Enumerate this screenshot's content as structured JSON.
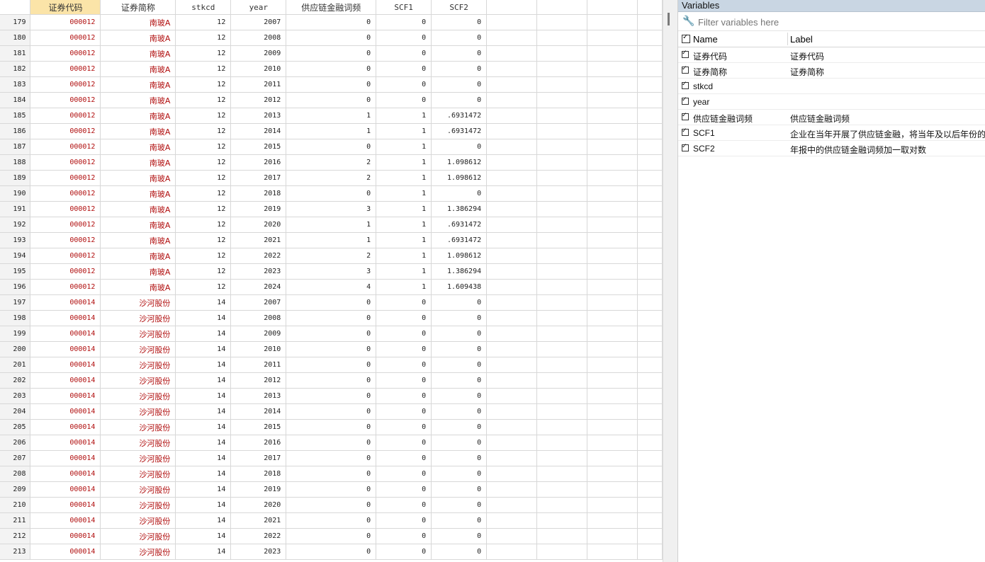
{
  "grid": {
    "columns": [
      "证券代码",
      "证券简称",
      "stkcd",
      "year",
      "供应链金融词频",
      "SCF1",
      "SCF2"
    ],
    "rows": [
      [
        "179",
        "000012",
        "南玻A",
        "12",
        "2007",
        "0",
        "0",
        "0"
      ],
      [
        "180",
        "000012",
        "南玻A",
        "12",
        "2008",
        "0",
        "0",
        "0"
      ],
      [
        "181",
        "000012",
        "南玻A",
        "12",
        "2009",
        "0",
        "0",
        "0"
      ],
      [
        "182",
        "000012",
        "南玻A",
        "12",
        "2010",
        "0",
        "0",
        "0"
      ],
      [
        "183",
        "000012",
        "南玻A",
        "12",
        "2011",
        "0",
        "0",
        "0"
      ],
      [
        "184",
        "000012",
        "南玻A",
        "12",
        "2012",
        "0",
        "0",
        "0"
      ],
      [
        "185",
        "000012",
        "南玻A",
        "12",
        "2013",
        "1",
        "1",
        ".6931472"
      ],
      [
        "186",
        "000012",
        "南玻A",
        "12",
        "2014",
        "1",
        "1",
        ".6931472"
      ],
      [
        "187",
        "000012",
        "南玻A",
        "12",
        "2015",
        "0",
        "1",
        "0"
      ],
      [
        "188",
        "000012",
        "南玻A",
        "12",
        "2016",
        "2",
        "1",
        "1.098612"
      ],
      [
        "189",
        "000012",
        "南玻A",
        "12",
        "2017",
        "2",
        "1",
        "1.098612"
      ],
      [
        "190",
        "000012",
        "南玻A",
        "12",
        "2018",
        "0",
        "1",
        "0"
      ],
      [
        "191",
        "000012",
        "南玻A",
        "12",
        "2019",
        "3",
        "1",
        "1.386294"
      ],
      [
        "192",
        "000012",
        "南玻A",
        "12",
        "2020",
        "1",
        "1",
        ".6931472"
      ],
      [
        "193",
        "000012",
        "南玻A",
        "12",
        "2021",
        "1",
        "1",
        ".6931472"
      ],
      [
        "194",
        "000012",
        "南玻A",
        "12",
        "2022",
        "2",
        "1",
        "1.098612"
      ],
      [
        "195",
        "000012",
        "南玻A",
        "12",
        "2023",
        "3",
        "1",
        "1.386294"
      ],
      [
        "196",
        "000012",
        "南玻A",
        "12",
        "2024",
        "4",
        "1",
        "1.609438"
      ],
      [
        "197",
        "000014",
        "沙河股份",
        "14",
        "2007",
        "0",
        "0",
        "0"
      ],
      [
        "198",
        "000014",
        "沙河股份",
        "14",
        "2008",
        "0",
        "0",
        "0"
      ],
      [
        "199",
        "000014",
        "沙河股份",
        "14",
        "2009",
        "0",
        "0",
        "0"
      ],
      [
        "200",
        "000014",
        "沙河股份",
        "14",
        "2010",
        "0",
        "0",
        "0"
      ],
      [
        "201",
        "000014",
        "沙河股份",
        "14",
        "2011",
        "0",
        "0",
        "0"
      ],
      [
        "202",
        "000014",
        "沙河股份",
        "14",
        "2012",
        "0",
        "0",
        "0"
      ],
      [
        "203",
        "000014",
        "沙河股份",
        "14",
        "2013",
        "0",
        "0",
        "0"
      ],
      [
        "204",
        "000014",
        "沙河股份",
        "14",
        "2014",
        "0",
        "0",
        "0"
      ],
      [
        "205",
        "000014",
        "沙河股份",
        "14",
        "2015",
        "0",
        "0",
        "0"
      ],
      [
        "206",
        "000014",
        "沙河股份",
        "14",
        "2016",
        "0",
        "0",
        "0"
      ],
      [
        "207",
        "000014",
        "沙河股份",
        "14",
        "2017",
        "0",
        "0",
        "0"
      ],
      [
        "208",
        "000014",
        "沙河股份",
        "14",
        "2018",
        "0",
        "0",
        "0"
      ],
      [
        "209",
        "000014",
        "沙河股份",
        "14",
        "2019",
        "0",
        "0",
        "0"
      ],
      [
        "210",
        "000014",
        "沙河股份",
        "14",
        "2020",
        "0",
        "0",
        "0"
      ],
      [
        "211",
        "000014",
        "沙河股份",
        "14",
        "2021",
        "0",
        "0",
        "0"
      ],
      [
        "212",
        "000014",
        "沙河股份",
        "14",
        "2022",
        "0",
        "0",
        "0"
      ],
      [
        "213",
        "000014",
        "沙河股份",
        "14",
        "2023",
        "0",
        "0",
        "0"
      ]
    ]
  },
  "variables": {
    "title": "Variables",
    "filter_placeholder": "Filter variables here",
    "header": {
      "name": "Name",
      "label": "Label"
    },
    "items": [
      {
        "name": "证券代码",
        "label": "证券代码"
      },
      {
        "name": "证券简称",
        "label": "证券简称"
      },
      {
        "name": "stkcd",
        "label": ""
      },
      {
        "name": "year",
        "label": ""
      },
      {
        "name": "供应链金融词频",
        "label": "供应链金融词频"
      },
      {
        "name": "SCF1",
        "label": "企业在当年开展了供应链金融，将当年及以后年份的"
      },
      {
        "name": "SCF2",
        "label": "年报中的供应链金融词频加一取对数"
      }
    ]
  },
  "colors": {
    "string_text": "#b10f0f",
    "selected_header": "#fbe4a8",
    "panel_title": "#c9d6e3"
  }
}
